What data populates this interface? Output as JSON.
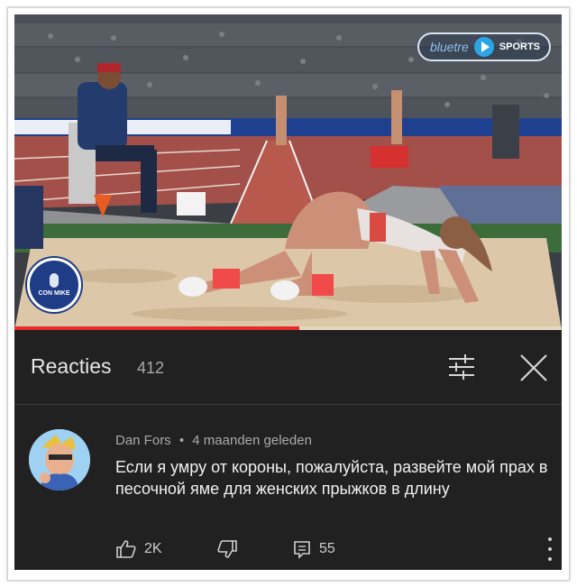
{
  "video": {
    "watermark": {
      "left": "bluetre",
      "right": "SPORTS"
    },
    "channel_badge": "CON MIKE",
    "progress": 0.52
  },
  "comments_panel": {
    "title": "Reacties",
    "count": "412",
    "icons": {
      "sort": "sliders-icon",
      "close": "close-icon"
    }
  },
  "comment": {
    "author": "Dan Fors",
    "separator": "•",
    "time": "4 maanden geleden",
    "text": "Если я умру от короны, пожалуйста, развейте мой прах в песочной яме для женских прыжков в длину",
    "likes": "2K",
    "replies": "55",
    "icons": {
      "like": "thumbs-up-icon",
      "dislike": "thumbs-down-icon",
      "reply": "reply-icon",
      "more": "more-vertical-icon"
    }
  },
  "colors": {
    "panel_bg": "#212121",
    "progress": "#e52b2b",
    "text": "#f1f1f1",
    "muted": "#aaaaaa"
  }
}
